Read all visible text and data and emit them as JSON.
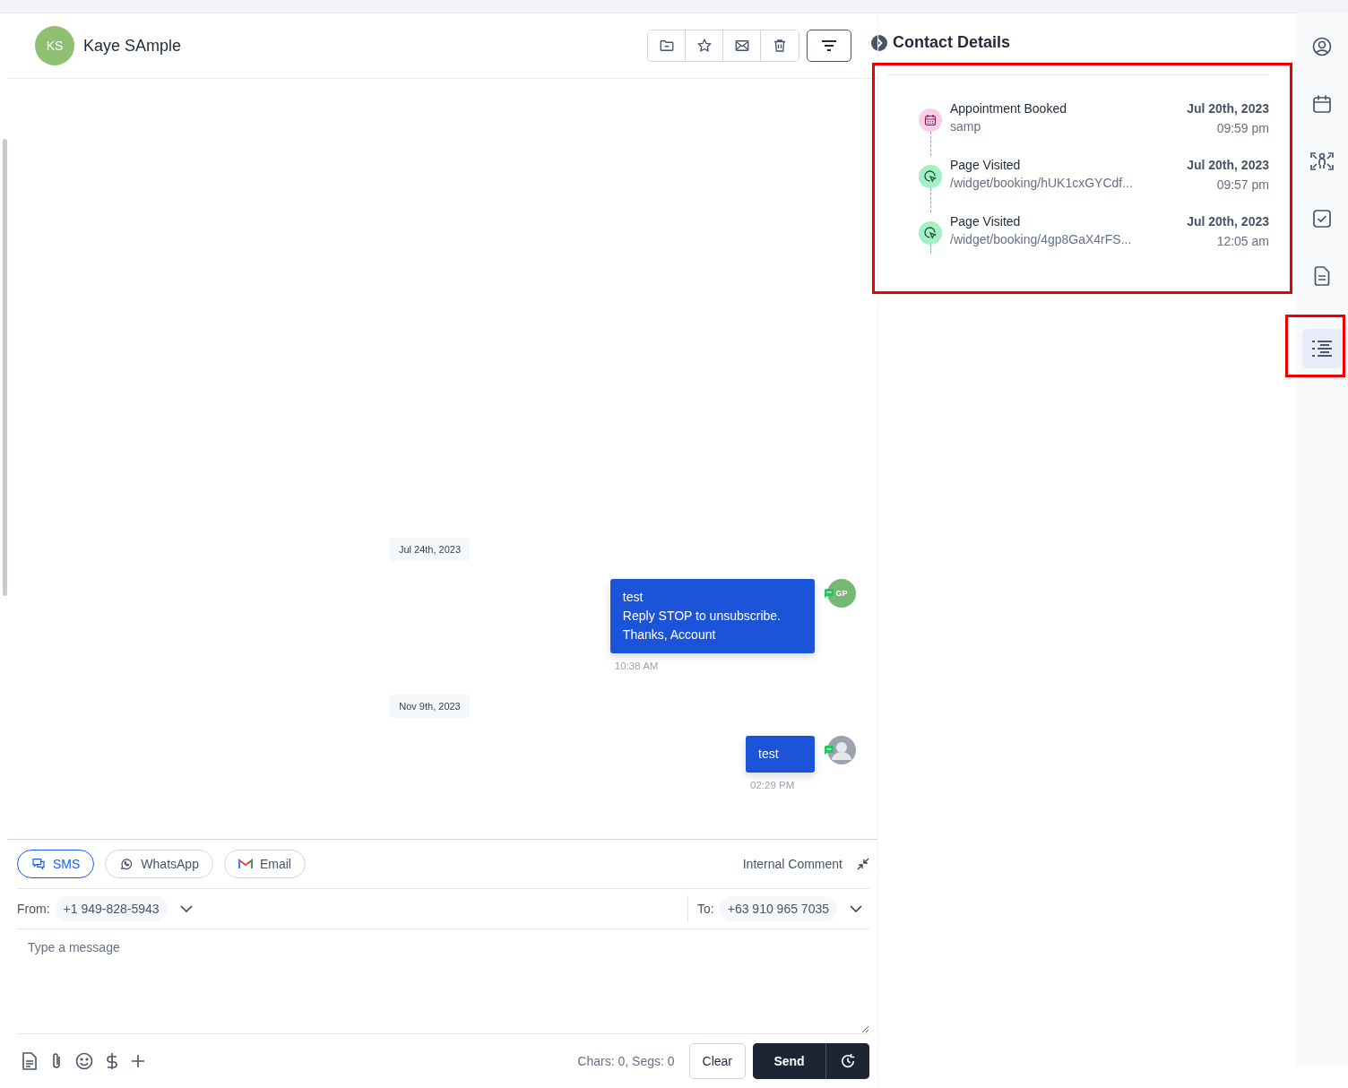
{
  "contact": {
    "initials": "KS",
    "name": "Kaye SAmple"
  },
  "messages": [
    {
      "date": "Jul 24th, 2023",
      "text": "test\nReply STOP to unsubscribe.\nThanks, Account",
      "time": "10:38 AM",
      "avatar": {
        "kind": "initials",
        "initials": "GP"
      }
    },
    {
      "date": "Nov 9th, 2023",
      "text": "test",
      "time": "02:29 PM",
      "avatar": {
        "kind": "photo"
      }
    }
  ],
  "channels": [
    {
      "label": "SMS",
      "selected": true
    },
    {
      "label": "WhatsApp",
      "selected": false
    },
    {
      "label": "Email",
      "selected": false
    }
  ],
  "internal_comment": "Internal Comment",
  "from": {
    "label": "From:",
    "value": "+1 949-828-5943"
  },
  "to": {
    "label": "To:",
    "value": "+63 910 965 7035"
  },
  "message_field": {
    "placeholder": "Type a message"
  },
  "counter": "Chars: 0, Segs: 0",
  "buttons": {
    "clear": "Clear",
    "send": "Send"
  },
  "details": {
    "title": "Contact Details",
    "activities": [
      {
        "kind": "appointment",
        "title": "Appointment Booked",
        "detail": "samp",
        "date": "Jul 20th, 2023",
        "time": "09:59 pm"
      },
      {
        "kind": "page",
        "title": "Page Visited",
        "detail": "/widget/booking/hUK1cxGYCdf...",
        "date": "Jul 20th, 2023",
        "time": "09:57 pm"
      },
      {
        "kind": "page",
        "title": "Page Visited",
        "detail": "/widget/booking/4gp8GaX4rFS...",
        "date": "Jul 20th, 2023",
        "time": "12:05 am"
      }
    ]
  },
  "rail": [
    {
      "selected": false
    },
    {
      "selected": false
    },
    {
      "selected": false
    },
    {
      "selected": false
    },
    {
      "selected": false
    },
    {
      "selected": true
    }
  ]
}
